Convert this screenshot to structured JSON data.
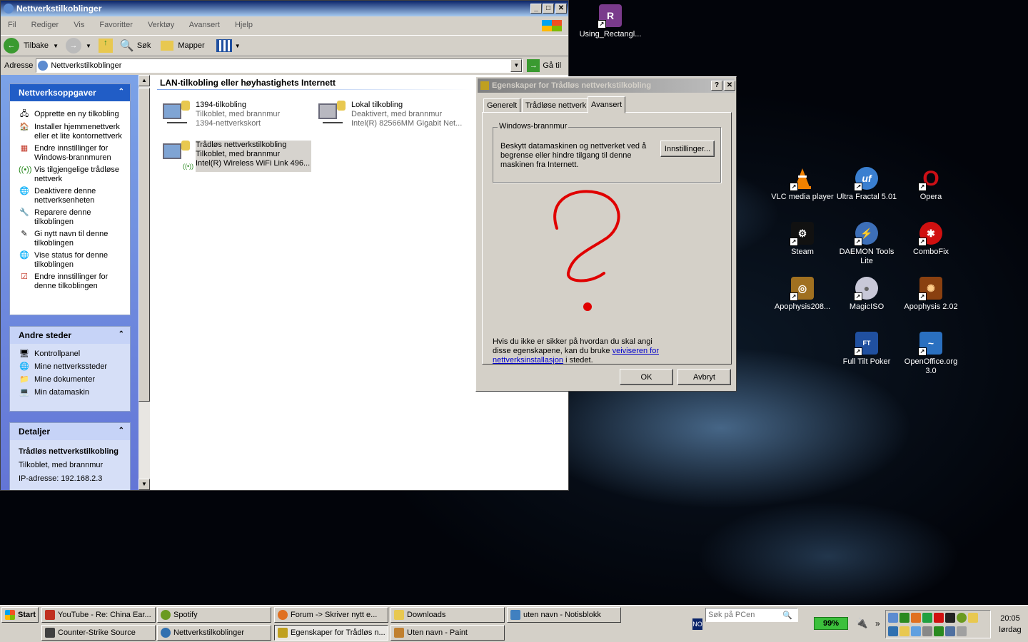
{
  "explorer": {
    "title": "Nettverkstilkoblinger",
    "menu": [
      "Fil",
      "Rediger",
      "Vis",
      "Favoritter",
      "Verktøy",
      "Avansert",
      "Hjelp"
    ],
    "toolbar": {
      "back": "Tilbake",
      "search": "Søk",
      "folders": "Mapper"
    },
    "address": {
      "label": "Adresse",
      "value": "Nettverkstilkoblinger",
      "go": "Gå til"
    },
    "section_header": "LAN-tilkobling eller høyhastighets Internett",
    "tasks": {
      "title": "Nettverksoppgaver",
      "items": [
        "Opprette en ny tilkobling",
        "Installer hjemmenettverk eller et lite kontornettverk",
        "Endre innstillinger for Windows-brannmuren",
        "Vis tilgjengelige trådløse nettverk",
        "Deaktivere denne nettverksenheten",
        "Reparere denne tilkoblingen",
        "Gi nytt navn til denne tilkoblingen",
        "Vise status for denne tilkoblingen",
        "Endre innstillinger for denne tilkoblingen"
      ]
    },
    "other_places": {
      "title": "Andre steder",
      "items": [
        "Kontrollpanel",
        "Mine nettverkssteder",
        "Mine dokumenter",
        "Min datamaskin"
      ]
    },
    "details": {
      "title": "Detaljer",
      "name": "Trådløs nettverkstilkobling",
      "status": "Tilkoblet, med brannmur",
      "ip": "IP-adresse: 192.168.2.3"
    },
    "connections": [
      {
        "name": "1394-tilkobling",
        "status": "Tilkoblet, med brannmur",
        "device": "1394-nettverkskort"
      },
      {
        "name": "Lokal tilkobling",
        "status": "Deaktivert, med brannmur",
        "device": "Intel(R) 82566MM Gigabit Net..."
      },
      {
        "name": "Trådløs nettverkstilkobling",
        "status": "Tilkoblet, med brannmur",
        "device": "Intel(R) Wireless WiFi Link 496..."
      }
    ]
  },
  "dialog": {
    "title": "Egenskaper for Trådløs nettverkstilkobling",
    "tabs": [
      "Generelt",
      "Trådløse nettverk",
      "Avansert"
    ],
    "group_title": "Windows-brannmur",
    "group_text": "Beskytt datamaskinen og nettverket ved å begrense eller hindre tilgang til denne maskinen fra Internett.",
    "settings_button": "Innstillinger...",
    "help_text": "Hvis du ikke er sikker på hvordan du skal angi disse egenskapene, kan du bruke",
    "help_link": "veiviseren for nettverksinstallasjon",
    "help_tail": "i stedet.",
    "ok": "OK",
    "cancel": "Avbryt",
    "drawing_color": "#e00000"
  },
  "desktop_icons": [
    {
      "label": "Using_Rectangl...",
      "color": "#7a3b8c",
      "icon": "winrar-icon"
    },
    {
      "label": "VLC media player",
      "color": "#f08000",
      "icon": "vlc-icon"
    },
    {
      "label": "Ultra Fractal 5.01",
      "color": "#3a7fd0",
      "icon": "ultra-fractal-icon"
    },
    {
      "label": "Opera",
      "color": "#cc0f16",
      "icon": "opera-icon"
    },
    {
      "label": "Steam",
      "color": "#111111",
      "icon": "steam-icon"
    },
    {
      "label": "DAEMON Tools Lite",
      "color": "#3d6fb8",
      "icon": "daemon-tools-icon"
    },
    {
      "label": "ComboFix",
      "color": "#d01010",
      "icon": "combofix-icon"
    },
    {
      "label": "Apophysis208...",
      "color": "#a07020",
      "icon": "apophysis-icon"
    },
    {
      "label": "MagicISO",
      "color": "#c8c8d8",
      "icon": "magiciso-icon"
    },
    {
      "label": "Apophysis 2.02",
      "color": "#8a4010",
      "icon": "apophysis-202-icon"
    },
    {
      "label": "Full Tilt Poker",
      "color": "#2050a0",
      "icon": "full-tilt-icon"
    },
    {
      "label": "OpenOffice.org 3.0",
      "color": "#2a70c0",
      "icon": "openoffice-icon"
    }
  ],
  "taskbar": {
    "start": "Start",
    "row1": [
      {
        "label": "YouTube - Re: China Ear...",
        "color": "#c03020"
      },
      {
        "label": "Spotify",
        "color": "#6a9a20"
      },
      {
        "label": "Forum -> Skriver nytt e...",
        "color": "#e07020"
      },
      {
        "label": "Downloads",
        "color": "#e8c850"
      },
      {
        "label": "uten navn - Notisblokk",
        "color": "#4080c0"
      }
    ],
    "row2": [
      {
        "label": "Counter-Strike Source",
        "color": "#404040"
      },
      {
        "label": "Nettverkstilkoblinger",
        "color": "#3070b0"
      },
      {
        "label": "Egenskaper for Trådløs n...",
        "color": "#c0a020"
      },
      {
        "label": "Uten navn - Paint",
        "color": "#c08030"
      }
    ],
    "search_placeholder": "Søk på PCen",
    "lang": "NO",
    "battery": "99%",
    "time": "20:05",
    "day": "lørdag"
  }
}
